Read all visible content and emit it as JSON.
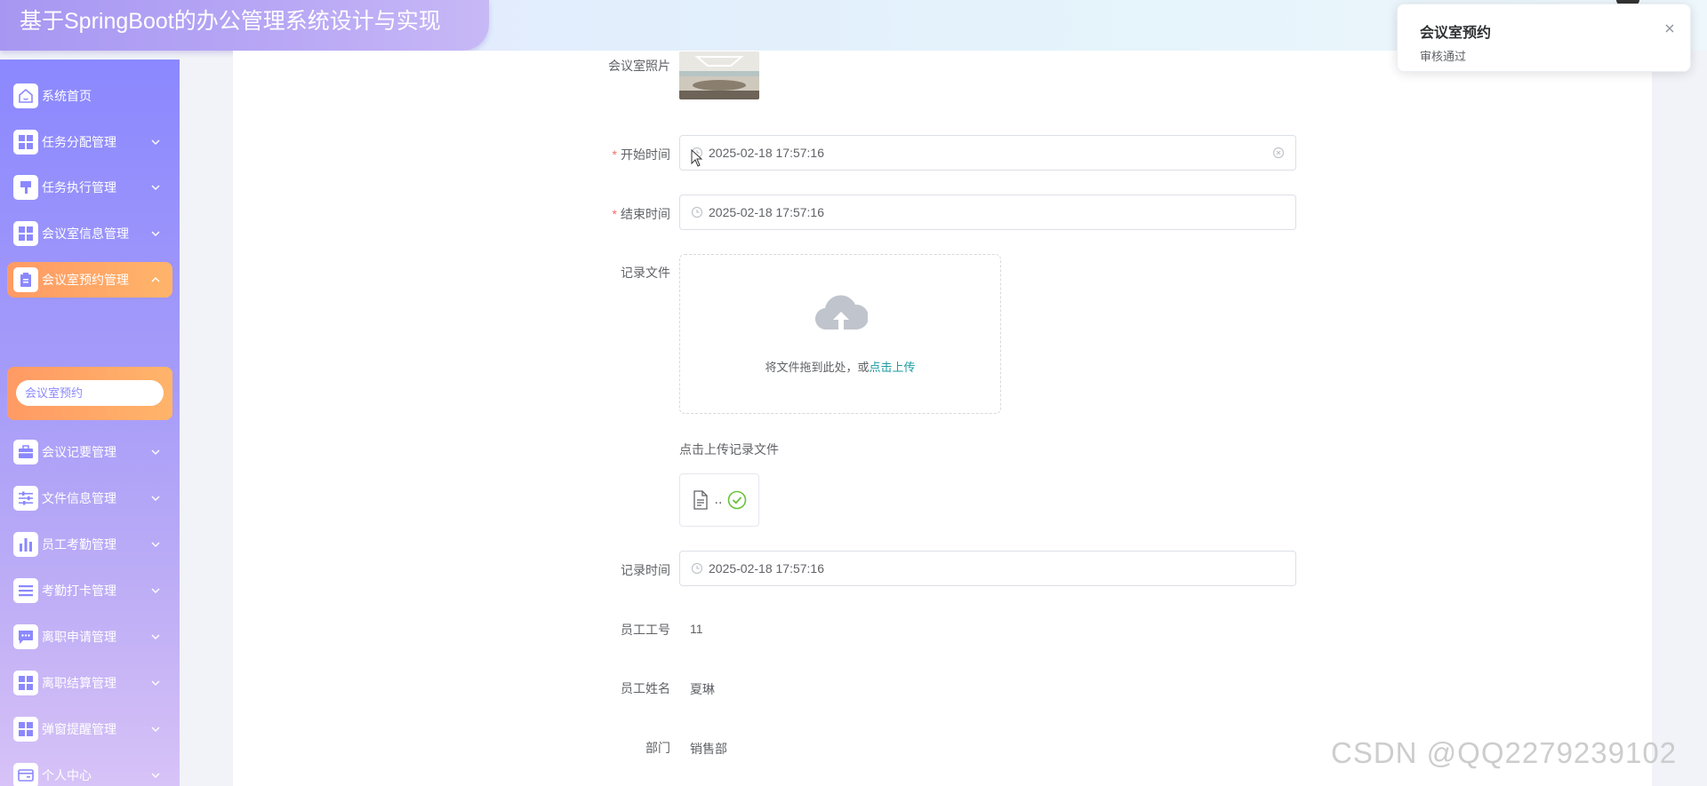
{
  "app": {
    "title": "基于SpringBoot的办公管理系统设计与实现"
  },
  "sidebar": {
    "items": [
      {
        "label": "系统首页",
        "icon": "home-icon",
        "has_children": false
      },
      {
        "label": "任务分配管理",
        "icon": "grid-icon",
        "has_children": true
      },
      {
        "label": "任务执行管理",
        "icon": "brush-icon",
        "has_children": true
      },
      {
        "label": "会议室信息管理",
        "icon": "grid-icon",
        "has_children": true
      },
      {
        "label": "会议室预约管理",
        "icon": "clipboard-icon",
        "has_children": true,
        "active": true
      },
      {
        "label": "会议记要管理",
        "icon": "briefcase-icon",
        "has_children": true
      },
      {
        "label": "文件信息管理",
        "icon": "sliders-icon",
        "has_children": true
      },
      {
        "label": "员工考勤管理",
        "icon": "bar-chart-icon",
        "has_children": true
      },
      {
        "label": "考勤打卡管理",
        "icon": "list-icon",
        "has_children": true
      },
      {
        "label": "离职申请管理",
        "icon": "chat-icon",
        "has_children": true
      },
      {
        "label": "离职结算管理",
        "icon": "grid-icon",
        "has_children": true
      },
      {
        "label": "弹窗提醒管理",
        "icon": "grid-icon",
        "has_children": true
      },
      {
        "label": "个人中心",
        "icon": "card-icon",
        "has_children": true
      }
    ],
    "submenu": {
      "label": "会议室预约"
    }
  },
  "form": {
    "photo_label": "会议室照片",
    "start_time": {
      "label": "开始时间",
      "required": true,
      "value": "2025-02-18 17:57:16"
    },
    "end_time": {
      "label": "结束时间",
      "required": true,
      "value": "2025-02-18 17:57:16"
    },
    "record_file": {
      "label": "记录文件",
      "upload_text": "将文件拖到此处，或",
      "upload_link": "点击上传",
      "tip": "点击上传记录文件",
      "file_name": ".."
    },
    "record_time": {
      "label": "记录时间",
      "value": "2025-02-18 17:57:16"
    },
    "employee_no": {
      "label": "员工工号",
      "value": "11"
    },
    "employee_name": {
      "label": "员工姓名",
      "value": "夏琳"
    },
    "department": {
      "label": "部门",
      "value": "销售部"
    }
  },
  "notification": {
    "title": "会议室预约",
    "message": "审核通过"
  },
  "watermark": "CSDN @QQ2279239102",
  "colors": {
    "accent": "#8b88ff",
    "active": "#ffa868",
    "link": "#1a9ba1",
    "required": "#f56c6c"
  }
}
